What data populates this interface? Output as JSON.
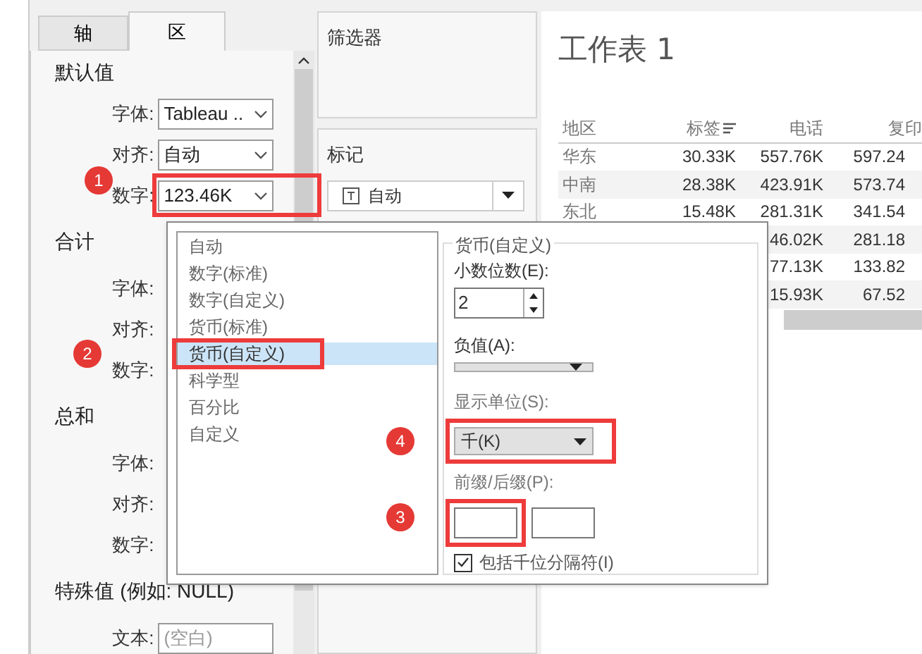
{
  "format_panel": {
    "tabs": [
      {
        "label": "轴",
        "selected": false
      },
      {
        "label": "区",
        "selected": true
      }
    ],
    "sections": [
      {
        "title": "默认值",
        "rows": [
          {
            "label": "字体:",
            "value": "Tableau .."
          },
          {
            "label": "对齐:",
            "value": "自动"
          },
          {
            "label": "数字:",
            "value": "123.46K"
          }
        ]
      },
      {
        "title": "合计",
        "rows": [
          {
            "label": "字体:"
          },
          {
            "label": "对齐:"
          },
          {
            "label": "数字:"
          }
        ]
      },
      {
        "title": "总和",
        "rows": [
          {
            "label": "字体:"
          },
          {
            "label": "对齐:"
          },
          {
            "label": "数字:"
          }
        ]
      },
      {
        "title": "特殊值 (例如: NULL)",
        "rows": [
          {
            "label": "文本:",
            "placeholder": "(空白)"
          }
        ]
      }
    ]
  },
  "filters_card": {
    "title": "筛选器"
  },
  "marks_card": {
    "title": "标记",
    "mark_type": "自动"
  },
  "worksheet": {
    "title": "工作表 1",
    "table": {
      "columns": [
        "地区",
        "标签",
        "电话",
        "复印"
      ],
      "rows": [
        [
          "华东",
          "30.33K",
          "557.76K",
          "597.24"
        ],
        [
          "中南",
          "28.38K",
          "423.91K",
          "573.74"
        ],
        [
          "东北",
          "15.48K",
          "281.31K",
          "341.54"
        ],
        [
          "",
          "",
          "46.02K",
          "281.18"
        ],
        [
          "",
          "",
          "77.13K",
          "133.82"
        ],
        [
          "",
          "",
          "15.93K",
          "67.52"
        ]
      ]
    }
  },
  "number_format_popup": {
    "categories": [
      {
        "label": "自动",
        "selected": false
      },
      {
        "label": "数字(标准)",
        "selected": false
      },
      {
        "label": "数字(自定义)",
        "selected": false
      },
      {
        "label": "货币(标准)",
        "selected": false
      },
      {
        "label": "货币(自定义)",
        "selected": true
      },
      {
        "label": "科学型",
        "selected": false
      },
      {
        "label": "百分比",
        "selected": false
      },
      {
        "label": "自定义",
        "selected": false
      }
    ],
    "group_title": "货币(自定义)",
    "decimals_label": "小数位数(E):",
    "decimals_value": "2",
    "negative_label": "负值(A):",
    "units_label": "显示单位(S):",
    "units_value": "千(K)",
    "prefix_suffix_label": "前缀/后缀(P):",
    "separator": {
      "label": "包括千位分隔符(I)",
      "checked": true
    }
  },
  "annotations": [
    {
      "label": "1"
    },
    {
      "label": "2"
    },
    {
      "label": "4"
    },
    {
      "label": "3"
    }
  ]
}
